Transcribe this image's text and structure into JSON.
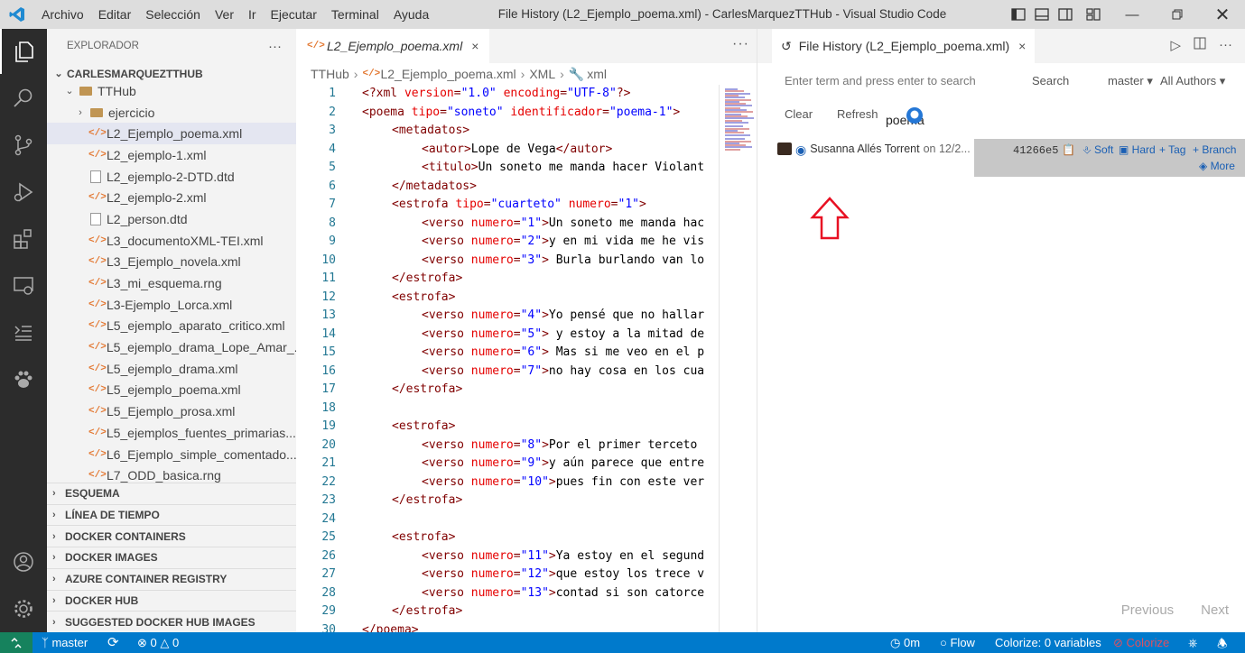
{
  "titlebar": {
    "menus": [
      "Archivo",
      "Editar",
      "Selección",
      "Ver",
      "Ir",
      "Ejecutar",
      "Terminal",
      "Ayuda"
    ],
    "title": "File History (L2_Ejemplo_poema.xml) - CarlesMarquezTTHub - Visual Studio Code"
  },
  "sidebar": {
    "header": "EXPLORADOR",
    "more": "···",
    "root": "CARLESMARQUEZTTHUB",
    "folder": "TTHub",
    "subfolder": "ejercicio",
    "files": [
      {
        "name": "L2_Ejemplo_poema.xml",
        "type": "xml",
        "selected": true
      },
      {
        "name": "L2_ejemplo-1.xml",
        "type": "xml"
      },
      {
        "name": "L2_ejemplo-2-DTD.dtd",
        "type": "dtd"
      },
      {
        "name": "L2_ejemplo-2.xml",
        "type": "xml"
      },
      {
        "name": "L2_person.dtd",
        "type": "dtd"
      },
      {
        "name": "L3_documentoXML-TEI.xml",
        "type": "xml"
      },
      {
        "name": "L3_Ejemplo_novela.xml",
        "type": "xml"
      },
      {
        "name": "L3_mi_esquema.rng",
        "type": "xml"
      },
      {
        "name": "L3-Ejemplo_Lorca.xml",
        "type": "xml"
      },
      {
        "name": "L5_ejemplo_aparato_critico.xml",
        "type": "xml"
      },
      {
        "name": "L5_ejemplo_drama_Lope_Amar_...",
        "type": "xml"
      },
      {
        "name": "L5_ejemplo_drama.xml",
        "type": "xml"
      },
      {
        "name": "L5_ejemplo_poema.xml",
        "type": "xml"
      },
      {
        "name": "L5_Ejemplo_prosa.xml",
        "type": "xml"
      },
      {
        "name": "L5_ejemplos_fuentes_primarias....",
        "type": "xml"
      },
      {
        "name": "L6_Ejemplo_simple_comentado....",
        "type": "xml"
      },
      {
        "name": "L7_ODD_basica.rng",
        "type": "xml"
      }
    ],
    "sections": [
      "ESQUEMA",
      "LÍNEA DE TIEMPO",
      "DOCKER CONTAINERS",
      "DOCKER IMAGES",
      "AZURE CONTAINER REGISTRY",
      "DOCKER HUB",
      "SUGGESTED DOCKER HUB IMAGES"
    ]
  },
  "editor": {
    "tab": "L2_Ejemplo_poema.xml",
    "tab_close": "×",
    "more": "···",
    "breadcrumbs": [
      "TTHub",
      "L2_Ejemplo_poema.xml",
      "XML",
      "xml"
    ],
    "lines": [
      {
        "n": "1",
        "indent": 0,
        "parts": [
          [
            "p",
            "<?xml "
          ],
          [
            "a",
            "version"
          ],
          [
            "t",
            "="
          ],
          [
            "v",
            "\"1.0\""
          ],
          [
            "t",
            " "
          ],
          [
            "a",
            "encoding"
          ],
          [
            "t",
            "="
          ],
          [
            "v",
            "\"UTF-8\""
          ],
          [
            "p",
            "?>"
          ]
        ]
      },
      {
        "n": "2",
        "indent": 0,
        "parts": [
          [
            "t",
            "<poema "
          ],
          [
            "a",
            "tipo"
          ],
          [
            "t",
            "="
          ],
          [
            "v",
            "\"soneto\""
          ],
          [
            "t",
            " "
          ],
          [
            "a",
            "identificador"
          ],
          [
            "t",
            "="
          ],
          [
            "v",
            "\"poema-1\""
          ],
          [
            "t",
            ">"
          ]
        ]
      },
      {
        "n": "3",
        "indent": 1,
        "parts": [
          [
            "t",
            "<metadatos>"
          ]
        ]
      },
      {
        "n": "4",
        "indent": 2,
        "parts": [
          [
            "t",
            "<autor>"
          ],
          [
            "x",
            "Lope de Vega"
          ],
          [
            "t",
            "</autor>"
          ]
        ]
      },
      {
        "n": "5",
        "indent": 2,
        "parts": [
          [
            "t",
            "<titulo>"
          ],
          [
            "x",
            "Un soneto me manda hacer Violant"
          ]
        ]
      },
      {
        "n": "6",
        "indent": 1,
        "parts": [
          [
            "t",
            "</metadatos>"
          ]
        ]
      },
      {
        "n": "7",
        "indent": 1,
        "parts": [
          [
            "t",
            "<estrofa "
          ],
          [
            "a",
            "tipo"
          ],
          [
            "t",
            "="
          ],
          [
            "v",
            "\"cuarteto\""
          ],
          [
            "t",
            " "
          ],
          [
            "a",
            "numero"
          ],
          [
            "t",
            "="
          ],
          [
            "v",
            "\"1\""
          ],
          [
            "t",
            ">"
          ]
        ]
      },
      {
        "n": "8",
        "indent": 2,
        "parts": [
          [
            "t",
            "<verso "
          ],
          [
            "a",
            "numero"
          ],
          [
            "t",
            "="
          ],
          [
            "v",
            "\"1\""
          ],
          [
            "t",
            ">"
          ],
          [
            "x",
            "Un soneto me manda hac"
          ]
        ]
      },
      {
        "n": "9",
        "indent": 2,
        "parts": [
          [
            "t",
            "<verso "
          ],
          [
            "a",
            "numero"
          ],
          [
            "t",
            "="
          ],
          [
            "v",
            "\"2\""
          ],
          [
            "t",
            ">"
          ],
          [
            "x",
            "y en mi vida me he vis"
          ]
        ]
      },
      {
        "n": "10",
        "indent": 2,
        "parts": [
          [
            "t",
            "<verso "
          ],
          [
            "a",
            "numero"
          ],
          [
            "t",
            "="
          ],
          [
            "v",
            "\"3\""
          ],
          [
            "t",
            ">"
          ],
          [
            "x",
            " Burla burlando van lo"
          ]
        ]
      },
      {
        "n": "11",
        "indent": 1,
        "parts": [
          [
            "t",
            "</estrofa>"
          ]
        ]
      },
      {
        "n": "12",
        "indent": 1,
        "parts": [
          [
            "t",
            "<estrofa>"
          ]
        ]
      },
      {
        "n": "13",
        "indent": 2,
        "parts": [
          [
            "t",
            "<verso "
          ],
          [
            "a",
            "numero"
          ],
          [
            "t",
            "="
          ],
          [
            "v",
            "\"4\""
          ],
          [
            "t",
            ">"
          ],
          [
            "x",
            "Yo pensé que no hallar"
          ]
        ]
      },
      {
        "n": "14",
        "indent": 2,
        "parts": [
          [
            "t",
            "<verso "
          ],
          [
            "a",
            "numero"
          ],
          [
            "t",
            "="
          ],
          [
            "v",
            "\"5\""
          ],
          [
            "t",
            ">"
          ],
          [
            "x",
            " y estoy a la mitad de"
          ]
        ]
      },
      {
        "n": "15",
        "indent": 2,
        "parts": [
          [
            "t",
            "<verso "
          ],
          [
            "a",
            "numero"
          ],
          [
            "t",
            "="
          ],
          [
            "v",
            "\"6\""
          ],
          [
            "t",
            ">"
          ],
          [
            "x",
            " Mas si me veo en el p"
          ]
        ]
      },
      {
        "n": "16",
        "indent": 2,
        "parts": [
          [
            "t",
            "<verso "
          ],
          [
            "a",
            "numero"
          ],
          [
            "t",
            "="
          ],
          [
            "v",
            "\"7\""
          ],
          [
            "t",
            ">"
          ],
          [
            "x",
            "no hay cosa en los cua"
          ]
        ]
      },
      {
        "n": "17",
        "indent": 1,
        "parts": [
          [
            "t",
            "</estrofa>"
          ]
        ]
      },
      {
        "n": "18",
        "indent": 0,
        "parts": []
      },
      {
        "n": "19",
        "indent": 1,
        "parts": [
          [
            "t",
            "<estrofa>"
          ]
        ]
      },
      {
        "n": "20",
        "indent": 2,
        "parts": [
          [
            "t",
            "<verso "
          ],
          [
            "a",
            "numero"
          ],
          [
            "t",
            "="
          ],
          [
            "v",
            "\"8\""
          ],
          [
            "t",
            ">"
          ],
          [
            "x",
            "Por el primer terceto"
          ]
        ]
      },
      {
        "n": "21",
        "indent": 2,
        "parts": [
          [
            "t",
            "<verso "
          ],
          [
            "a",
            "numero"
          ],
          [
            "t",
            "="
          ],
          [
            "v",
            "\"9\""
          ],
          [
            "t",
            ">"
          ],
          [
            "x",
            "y aún parece que entre"
          ]
        ]
      },
      {
        "n": "22",
        "indent": 2,
        "parts": [
          [
            "t",
            "<verso "
          ],
          [
            "a",
            "numero"
          ],
          [
            "t",
            "="
          ],
          [
            "v",
            "\"10\""
          ],
          [
            "t",
            ">"
          ],
          [
            "x",
            "pues fin con este ver"
          ]
        ]
      },
      {
        "n": "23",
        "indent": 1,
        "parts": [
          [
            "t",
            "</estrofa>"
          ]
        ]
      },
      {
        "n": "24",
        "indent": 0,
        "parts": []
      },
      {
        "n": "25",
        "indent": 1,
        "parts": [
          [
            "t",
            "<estrofa>"
          ]
        ]
      },
      {
        "n": "26",
        "indent": 2,
        "parts": [
          [
            "t",
            "<verso "
          ],
          [
            "a",
            "numero"
          ],
          [
            "t",
            "="
          ],
          [
            "v",
            "\"11\""
          ],
          [
            "t",
            ">"
          ],
          [
            "x",
            "Ya estoy en el segund"
          ]
        ]
      },
      {
        "n": "27",
        "indent": 2,
        "parts": [
          [
            "t",
            "<verso "
          ],
          [
            "a",
            "numero"
          ],
          [
            "t",
            "="
          ],
          [
            "v",
            "\"12\""
          ],
          [
            "t",
            ">"
          ],
          [
            "x",
            "que estoy los trece v"
          ]
        ]
      },
      {
        "n": "28",
        "indent": 2,
        "parts": [
          [
            "t",
            "<verso "
          ],
          [
            "a",
            "numero"
          ],
          [
            "t",
            "="
          ],
          [
            "v",
            "\"13\""
          ],
          [
            "t",
            ">"
          ],
          [
            "x",
            "contad si son catorce"
          ]
        ]
      },
      {
        "n": "29",
        "indent": 1,
        "parts": [
          [
            "t",
            "</estrofa>"
          ]
        ]
      },
      {
        "n": "30",
        "indent": 0,
        "parts": [
          [
            "t",
            "</poema>"
          ]
        ]
      }
    ]
  },
  "file_history": {
    "tab": "File History (L2_Ejemplo_poema.xml)",
    "tab_close": "×",
    "search_placeholder": "Enter term and press enter to search",
    "search_button": "Search",
    "branch": "master",
    "authors": "All Authors",
    "clear": "Clear",
    "refresh": "Refresh",
    "file_label": "poema",
    "commit": {
      "author": "Susanna Allés Torrent",
      "date": "on 12/2...",
      "hash": "41266e5",
      "soft": "Soft",
      "hard": "Hard",
      "tag": "+ Tag",
      "branch": "+ Branch",
      "more": "More"
    },
    "previous": "Previous",
    "next": "Next"
  },
  "statusbar": {
    "branch": "master",
    "problems_errors": "0",
    "problems_warnings": "0",
    "time": "0m",
    "flow": "Flow",
    "colorize_vars": "Colorize: 0 variables",
    "colorize": "Colorize"
  },
  "colors": {
    "accent": "#007acc",
    "activity_bg": "#2c2c2c",
    "sidebar_bg": "#f3f3f3",
    "annotation_arrow": "#e81123"
  }
}
